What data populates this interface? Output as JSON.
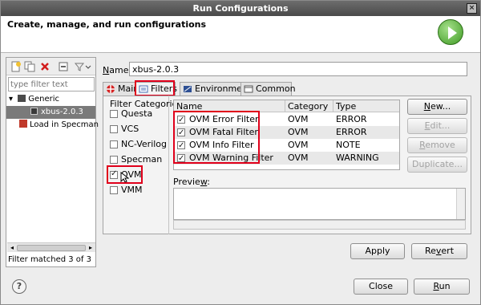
{
  "window": {
    "title": "Run Configurations"
  },
  "banner": {
    "title": "Create, manage, and run configurations"
  },
  "left_pane": {
    "filter_placeholder": "type filter text",
    "tree": [
      {
        "label": "Generic",
        "expanded": true
      },
      {
        "label": "xbus-2.0.3",
        "selected": true
      },
      {
        "label": "Load in Specman"
      }
    ],
    "status": "Filter matched 3 of 3 ite"
  },
  "name_field": {
    "label": "Name:",
    "value": "xbus-2.0.3"
  },
  "tabs": [
    {
      "label": "Main",
      "icon": "main-tab-icon"
    },
    {
      "label": "Filters",
      "icon": "filters-tab-icon",
      "active": true
    },
    {
      "label": "Environment",
      "icon": "environment-tab-icon"
    },
    {
      "label": "Common",
      "icon": "common-tab-icon"
    }
  ],
  "filter_categories": {
    "title": "Filter Categories",
    "items": [
      {
        "label": "Questa",
        "checked": false
      },
      {
        "label": "VCS",
        "checked": false
      },
      {
        "label": "NC-Verilog",
        "checked": false
      },
      {
        "label": "Specman",
        "checked": false
      },
      {
        "label": "OVM",
        "checked": true
      },
      {
        "label": "VMM",
        "checked": false
      }
    ]
  },
  "filters_table": {
    "columns": [
      "Name",
      "Category",
      "Type"
    ],
    "rows": [
      {
        "name": "OVM Error Filter",
        "category": "OVM",
        "type": "ERROR",
        "checked": true
      },
      {
        "name": "OVM Fatal Filter",
        "category": "OVM",
        "type": "ERROR",
        "checked": true
      },
      {
        "name": "OVM Info Filter",
        "category": "OVM",
        "type": "NOTE",
        "checked": true
      },
      {
        "name": "OVM Warning Filter",
        "category": "OVM",
        "type": "WARNING",
        "checked": true
      }
    ]
  },
  "side_buttons": {
    "new": "New...",
    "edit": "Edit...",
    "remove": "Remove",
    "duplicate": "Duplicate..."
  },
  "preview": {
    "label": "Preview:"
  },
  "actions": {
    "apply": "Apply",
    "revert": "Revert",
    "close": "Close",
    "run": "Run"
  },
  "accent_colors": {
    "highlight_box": "#e0001b",
    "selection": "#7a7a7a"
  }
}
